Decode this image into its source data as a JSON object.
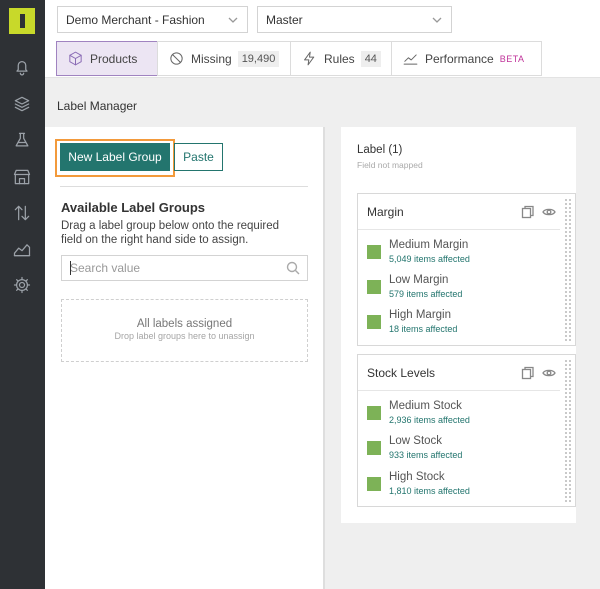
{
  "topbar": {
    "merchant": "Demo Merchant - Fashion",
    "environment": "Master"
  },
  "tabs": [
    {
      "label": "Products",
      "icon": "cube-icon",
      "active": true
    },
    {
      "label": "Missing",
      "icon": "ban-icon",
      "count": "19,490"
    },
    {
      "label": "Rules",
      "icon": "bolt-icon",
      "count": "44"
    },
    {
      "label": "Performance",
      "icon": "chart-line-icon",
      "badge": "BETA"
    }
  ],
  "page": {
    "title": "Label Manager"
  },
  "left": {
    "new_label_group": "New Label Group",
    "paste": "Paste",
    "available_title": "Available Label Groups",
    "available_desc": "Drag a label group below onto the required field on the right hand side to assign.",
    "search_placeholder": "Search value",
    "dropzone_title": "All labels assigned",
    "dropzone_sub": "Drop label groups here to unassign"
  },
  "right": {
    "title": "Label (1)",
    "subtitle": "Field not mapped",
    "groups": [
      {
        "title": "Margin",
        "items": [
          {
            "name": "Medium Margin",
            "count": "5,049 items affected"
          },
          {
            "name": "Low Margin",
            "count": "579 items affected"
          },
          {
            "name": "High Margin",
            "count": "18 items affected"
          }
        ]
      },
      {
        "title": "Stock Levels",
        "items": [
          {
            "name": "Medium Stock",
            "count": "2,936 items affected"
          },
          {
            "name": "Low Stock",
            "count": "933 items affected"
          },
          {
            "name": "High Stock",
            "count": "1,810 items affected"
          }
        ]
      }
    ]
  },
  "colors": {
    "accent": "#23756e",
    "swatch": "#7db257",
    "highlight": "#f39a3b",
    "logo": "#c8d92a",
    "sidebar": "#2e3135",
    "active_tab": "#ece5f3"
  }
}
